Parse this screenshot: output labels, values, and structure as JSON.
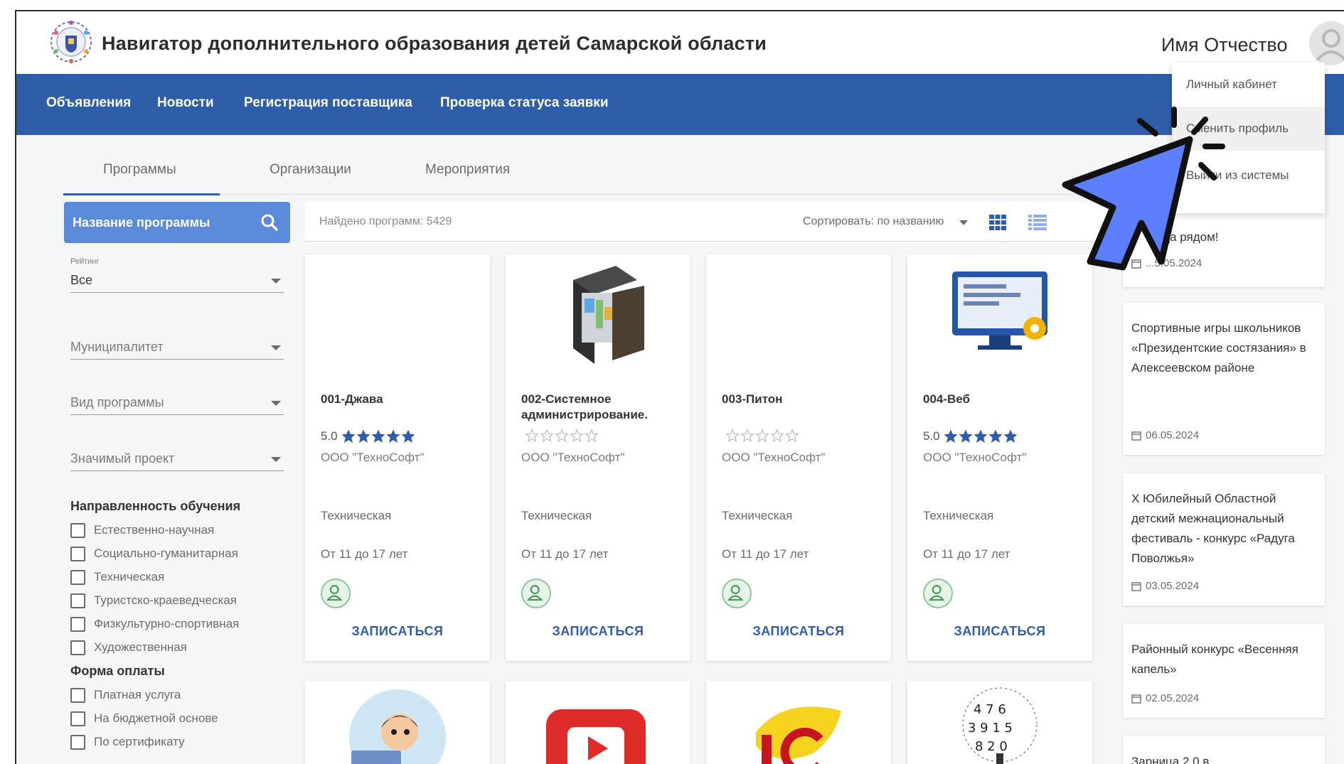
{
  "header": {
    "site_title": "Навигатор дополнительного образования детей Самарской области",
    "user_name": "Имя Отчество"
  },
  "nav": {
    "items": [
      {
        "label": "Объявления"
      },
      {
        "label": "Новости"
      },
      {
        "label": "Регистрация поставщика"
      },
      {
        "label": "Проверка статуса заявки"
      }
    ]
  },
  "tabs": [
    {
      "label": "Программы",
      "active": true
    },
    {
      "label": "Организации",
      "active": false
    },
    {
      "label": "Мероприятия",
      "active": false
    }
  ],
  "search": {
    "placeholder": "Название программы"
  },
  "filters": {
    "rating": {
      "label": "Рейтинг",
      "value": "Все"
    },
    "municipality": {
      "placeholder": "Муниципалитет"
    },
    "program_type": {
      "placeholder": "Вид программы"
    },
    "significant_project": {
      "placeholder": "Значимый проект"
    },
    "direction": {
      "title": "Направленность обучения",
      "options": [
        "Естественно-научная",
        "Социально-гуманитарная",
        "Техническая",
        "Туристско-краеведческая",
        "Физкультурно-спортивная",
        "Художественная"
      ]
    },
    "payment": {
      "title": "Форма оплаты",
      "options": [
        "Платная услуга",
        "На бюджетной основе",
        "По сертификату"
      ]
    }
  },
  "results": {
    "found": "Найдено программ: 5429",
    "sort": "Сортировать: по названию"
  },
  "cards": [
    {
      "title": "001-Джава",
      "rating": "5.0",
      "filled": 5,
      "org": "ООО \"ТехноСофт\"",
      "kind": "Техническая",
      "age": "От 11 до 17 лет",
      "action": "ЗАПИСАТЬСЯ",
      "image": "none"
    },
    {
      "title": "002-Системное администрирование.",
      "rating": "",
      "filled": 0,
      "org": "ООО \"ТехноСофт\"",
      "kind": "Техническая",
      "age": "От 11 до 17 лет",
      "action": "ЗАПИСАТЬСЯ",
      "image": "server-icon"
    },
    {
      "title": "003-Питон",
      "rating": "",
      "filled": 0,
      "org": "ООО \"ТехноСофт\"",
      "kind": "Техническая",
      "age": "От 11 до 17 лет",
      "action": "ЗАПИСАТЬСЯ",
      "image": "none"
    },
    {
      "title": "004-Веб",
      "rating": "5.0",
      "filled": 5,
      "org": "ООО \"ТехноСофт\"",
      "kind": "Техническая",
      "age": "От 11 до 17 лет",
      "action": "ЗАПИСАТЬСЯ",
      "image": "monitor-gear-icon"
    }
  ],
  "bottom_cards": [
    {
      "image": "kid-laptop-icon"
    },
    {
      "image": "youtube-icon"
    },
    {
      "image": "1c-logo-icon"
    },
    {
      "image": "number-tree-icon"
    }
  ],
  "news": [
    {
      "title": "...да рядом!",
      "date": "...5.05.2024"
    },
    {
      "title": "Спортивные игры школьников «Президентские состязания» в Алексеевском районе",
      "date": "06.05.2024"
    },
    {
      "title": "Х Юбилейный Областной детский межнациональный фестиваль - конкурс «Радуга Поволжья»",
      "date": "03.05.2024"
    },
    {
      "title": "Районный конкурс «Весенняя капель»",
      "date": "02.05.2024"
    },
    {
      "title": "Зарница 2.0 в",
      "date": ""
    }
  ],
  "user_menu": {
    "items": [
      {
        "label": "Личный кабинет"
      },
      {
        "label": "Сменить профиль"
      },
      {
        "label": "Выйти из системы"
      }
    ]
  },
  "colors": {
    "nav_bg": "#2f5ea8",
    "search_bg": "#5a8ad8",
    "star": "#2f5ea8",
    "cursor": "#5b7fff"
  }
}
